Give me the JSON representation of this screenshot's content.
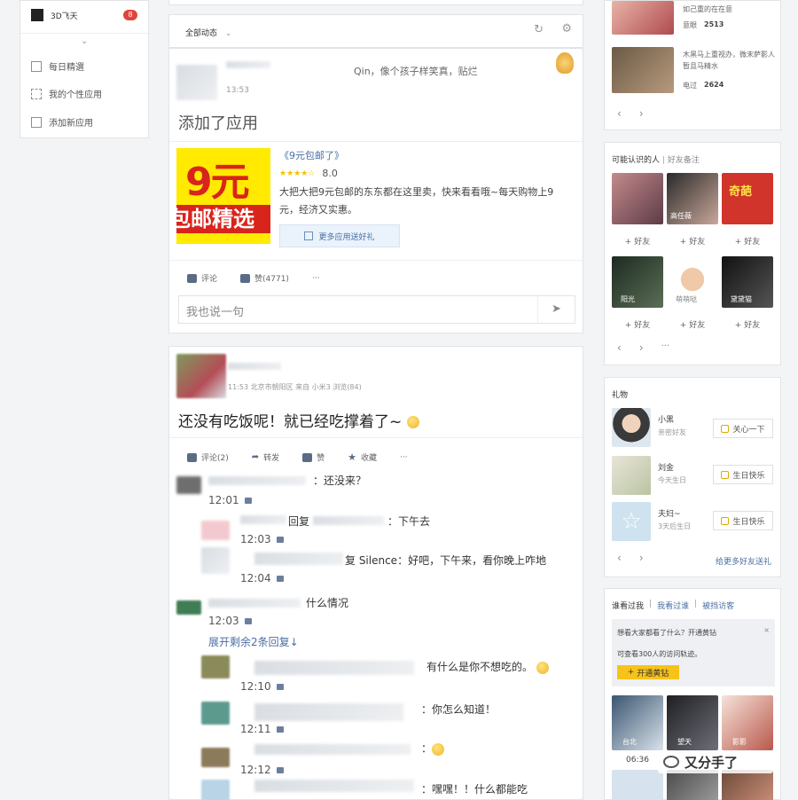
{
  "left_nav": {
    "user_name": "3D飞天",
    "badge": "8",
    "items": [
      {
        "label": "每日精選"
      },
      {
        "label": "我的个性应用"
      },
      {
        "label": "添加新应用"
      }
    ]
  },
  "feed_header": {
    "filter_label": "全部动态"
  },
  "post1": {
    "time": "13:53",
    "signature": "Qin，像个孩子样笑真，贴烂",
    "action_text": "添加了应用",
    "app": {
      "banner_line1": "9元",
      "banner_line2": "包邮精选",
      "title": "《9元包邮了》",
      "rating": "8.0",
      "description": "大把大把9元包邮的东东都在这里卖，快来看看哦~每天购物上9元，经济又实惠。",
      "more_button": "更多应用送好礼"
    },
    "actions": {
      "comment": "评论",
      "like": "赞(4771)",
      "more": "···"
    },
    "reply_placeholder": "我也说一句"
  },
  "post2": {
    "meta": "11:53  北京市朝阳区 来自 小米3  浏览(84)",
    "content": "还没有吃饭呢！就已经吃撑着了~",
    "actions": {
      "comment": "评论(2)",
      "share": "转发",
      "like": "赞",
      "fav": "收藏",
      "more": "···"
    },
    "comments": [
      {
        "text": "：还没来？",
        "time": "12:01"
      },
      {
        "text_a": "回复",
        "text_b": "：下午去",
        "time": "12:03"
      },
      {
        "text_a": "复 Silence",
        "text_b": "：好吧，下午来，看你晚上咋地",
        "time": "12:04"
      },
      {
        "text": "什么情况",
        "time": "12:03"
      },
      {
        "expand": "展开剩余2条回复↓"
      },
      {
        "text": "有什么是你不想吃的。",
        "time": "12:10"
      },
      {
        "text": "：你怎么知道！",
        "time": "12:11"
      },
      {
        "text": "：",
        "time": "12:12"
      },
      {
        "text": "：嘿嘿！！什么都能吃"
      }
    ]
  },
  "right": {
    "visitors": [
      {
        "line1": "如己重的在在意",
        "line2": "意眼",
        "num": "2513"
      },
      {
        "line1": "木黑马上重视办，微末萨影人暂且马精水",
        "line2": "电过",
        "num": "2624"
      }
    ],
    "maybe_know": {
      "title": "可能认识的人",
      "subtitle": "好友备注",
      "friends": [
        {
          "name": "",
          "add": "好友"
        },
        {
          "name": "高任薇",
          "add": "好友"
        },
        {
          "name": "奇葩",
          "add": "好友"
        },
        {
          "name": "阳光",
          "add": "好友"
        },
        {
          "name": "萌萌哒",
          "add": "好友"
        },
        {
          "name": "黛黛猫",
          "add": "好友"
        }
      ],
      "more": "···"
    },
    "gifts": {
      "title": "礼物",
      "items": [
        {
          "name": "小黑",
          "sub": "亲密好友",
          "btn": "关心一下"
        },
        {
          "name": "刘金",
          "sub": "今天生日",
          "btn": "生日快乐"
        },
        {
          "name": "夫妇~",
          "sub": "3天后生日",
          "btn": "生日快乐"
        }
      ],
      "footer": "给更多好友送礼"
    },
    "visits": {
      "tabs": [
        "谁看过我",
        "我看过谁",
        "被挡访客"
      ],
      "prompt": "想看大家都看了什么？开通黄钻",
      "sub": "可查看300人的访问轨迹。",
      "button": "开通黄钻",
      "people": [
        {
          "name": "台北"
        },
        {
          "name": "望天"
        },
        {
          "name": "影影"
        }
      ],
      "time": "06:36"
    }
  },
  "watermark": "又分手了",
  "colors": {
    "accent_red": "#d9241c",
    "banner_yellow": "#ffea00",
    "gold": "#f2c200"
  }
}
